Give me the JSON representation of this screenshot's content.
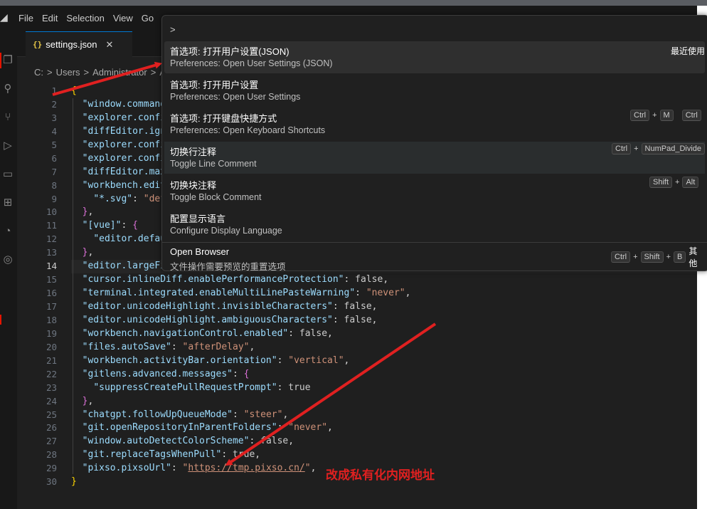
{
  "menu": {
    "items": [
      "File",
      "Edit",
      "Selection",
      "View",
      "Go"
    ]
  },
  "tab": {
    "icon": "{}",
    "label": "settings.json",
    "close": "✕"
  },
  "breadcrumb": [
    "C:",
    ">",
    "Users",
    ">",
    "Administrator",
    ">",
    "A"
  ],
  "editor": {
    "line_numbers": [
      "1",
      "2",
      "3",
      "4",
      "5",
      "6",
      "7",
      "8",
      "9",
      "10",
      "11",
      "12",
      "13",
      "14",
      "15",
      "16",
      "17",
      "18",
      "19",
      "20",
      "21",
      "22",
      "23",
      "24",
      "25",
      "26",
      "27",
      "28",
      "29",
      "30"
    ],
    "active_line": "14",
    "lines": [
      {
        "parts": [
          [
            "{",
            "br1"
          ]
        ]
      },
      {
        "parts": [
          [
            "  ",
            ""
          ],
          [
            "\"window.command",
            "k"
          ]
        ]
      },
      {
        "parts": [
          [
            "  ",
            ""
          ],
          [
            "\"explorer.confi",
            "k"
          ]
        ]
      },
      {
        "parts": [
          [
            "  ",
            ""
          ],
          [
            "\"diffEditor.ign",
            "k"
          ]
        ]
      },
      {
        "parts": [
          [
            "  ",
            ""
          ],
          [
            "\"explorer.confi",
            "k"
          ]
        ]
      },
      {
        "parts": [
          [
            "  ",
            ""
          ],
          [
            "\"explorer.confi",
            "k"
          ]
        ]
      },
      {
        "parts": [
          [
            "  ",
            ""
          ],
          [
            "\"diffEditor.max",
            "k"
          ]
        ]
      },
      {
        "parts": [
          [
            "  ",
            ""
          ],
          [
            "\"workbench.edit",
            "k"
          ]
        ]
      },
      {
        "parts": [
          [
            "    ",
            ""
          ],
          [
            "\"*.svg\"",
            "k"
          ],
          [
            ": ",
            "b"
          ],
          [
            "\"def",
            "s"
          ]
        ]
      },
      {
        "parts": [
          [
            "  ",
            ""
          ],
          [
            "}",
            "br2"
          ],
          [
            ",",
            "b"
          ]
        ]
      },
      {
        "parts": [
          [
            "  ",
            ""
          ],
          [
            "\"[vue]\"",
            "k"
          ],
          [
            ": ",
            "b"
          ],
          [
            "{",
            "br2"
          ]
        ]
      },
      {
        "parts": [
          [
            "    ",
            ""
          ],
          [
            "\"editor.defau",
            "k"
          ]
        ]
      },
      {
        "parts": [
          [
            "  ",
            ""
          ],
          [
            "}",
            "br2"
          ],
          [
            ",",
            "b"
          ]
        ]
      },
      {
        "parts": [
          [
            "  ",
            ""
          ],
          [
            "\"editor.largeFi",
            "k"
          ]
        ]
      },
      {
        "parts": [
          [
            "  ",
            ""
          ],
          [
            "\"cursor.inlineDiff.enablePerformanceProtection\"",
            "k"
          ],
          [
            ": ",
            "b"
          ],
          [
            "false",
            "kw"
          ],
          [
            ",",
            "b"
          ]
        ]
      },
      {
        "parts": [
          [
            "  ",
            ""
          ],
          [
            "\"terminal.integrated.enableMultiLinePasteWarning\"",
            "k"
          ],
          [
            ": ",
            "b"
          ],
          [
            "\"never\"",
            "s"
          ],
          [
            ",",
            "b"
          ]
        ]
      },
      {
        "parts": [
          [
            "  ",
            ""
          ],
          [
            "\"editor.unicodeHighlight.invisibleCharacters\"",
            "k"
          ],
          [
            ": ",
            "b"
          ],
          [
            "false",
            "kw"
          ],
          [
            ",",
            "b"
          ]
        ]
      },
      {
        "parts": [
          [
            "  ",
            ""
          ],
          [
            "\"editor.unicodeHighlight.ambiguousCharacters\"",
            "k"
          ],
          [
            ": ",
            "b"
          ],
          [
            "false",
            "kw"
          ],
          [
            ",",
            "b"
          ]
        ]
      },
      {
        "parts": [
          [
            "  ",
            ""
          ],
          [
            "\"workbench.navigationControl.enabled\"",
            "k"
          ],
          [
            ": ",
            "b"
          ],
          [
            "false",
            "kw"
          ],
          [
            ",",
            "b"
          ]
        ]
      },
      {
        "parts": [
          [
            "  ",
            ""
          ],
          [
            "\"files.autoSave\"",
            "k"
          ],
          [
            ": ",
            "b"
          ],
          [
            "\"afterDelay\"",
            "s"
          ],
          [
            ",",
            "b"
          ]
        ]
      },
      {
        "parts": [
          [
            "  ",
            ""
          ],
          [
            "\"workbench.activityBar.orientation\"",
            "k"
          ],
          [
            ": ",
            "b"
          ],
          [
            "\"vertical\"",
            "s"
          ],
          [
            ",",
            "b"
          ]
        ]
      },
      {
        "parts": [
          [
            "  ",
            ""
          ],
          [
            "\"gitlens.advanced.messages\"",
            "k"
          ],
          [
            ": ",
            "b"
          ],
          [
            "{",
            "br2"
          ]
        ]
      },
      {
        "parts": [
          [
            "    ",
            ""
          ],
          [
            "\"suppressCreatePullRequestPrompt\"",
            "k"
          ],
          [
            ": ",
            "b"
          ],
          [
            "true",
            "kw"
          ]
        ]
      },
      {
        "parts": [
          [
            "  ",
            ""
          ],
          [
            "}",
            "br2"
          ],
          [
            ",",
            "b"
          ]
        ]
      },
      {
        "parts": [
          [
            "  ",
            ""
          ],
          [
            "\"chatgpt.followUpQueueMode\"",
            "k"
          ],
          [
            ": ",
            "b"
          ],
          [
            "\"steer\"",
            "s"
          ],
          [
            ",",
            "b"
          ]
        ]
      },
      {
        "parts": [
          [
            "  ",
            ""
          ],
          [
            "\"git.openRepositoryInParentFolders\"",
            "k"
          ],
          [
            ": ",
            "b"
          ],
          [
            "\"never\"",
            "s"
          ],
          [
            ",",
            "b"
          ]
        ]
      },
      {
        "parts": [
          [
            "  ",
            ""
          ],
          [
            "\"window.autoDetectColorScheme\"",
            "k"
          ],
          [
            ": ",
            "b"
          ],
          [
            "false",
            "kw"
          ],
          [
            ",",
            "b"
          ]
        ]
      },
      {
        "parts": [
          [
            "  ",
            ""
          ],
          [
            "\"git.replaceTagsWhenPull\"",
            "k"
          ],
          [
            ": ",
            "b"
          ],
          [
            "true",
            "kw"
          ],
          [
            ",",
            "b"
          ]
        ]
      },
      {
        "parts": [
          [
            "  ",
            ""
          ],
          [
            "\"pixso.pixsoUrl\"",
            "k"
          ],
          [
            ": ",
            "b"
          ],
          [
            "\"",
            "s"
          ],
          [
            "https://tmp.pixso.cn/",
            "link"
          ],
          [
            "\"",
            "s"
          ],
          [
            ",",
            "b"
          ]
        ]
      },
      {
        "parts": [
          [
            "}",
            "br1"
          ]
        ]
      }
    ]
  },
  "palette": {
    "input_value": ">",
    "items": [
      {
        "title": "首选项: 打开用户设置(JSON)",
        "subtitle": "Preferences: Open User Settings (JSON)",
        "right_label": "最近使用",
        "keys": []
      },
      {
        "title": "首选项: 打开用户设置",
        "subtitle": "Preferences: Open User Settings",
        "right_label": "",
        "keys": []
      },
      {
        "title": "首选项: 打开键盘快捷方式",
        "subtitle": "Preferences: Open Keyboard Shortcuts",
        "right_label": "",
        "keys": [
          "Ctrl",
          "+",
          "M",
          "Ctrl"
        ]
      },
      {
        "title": "切换行注释",
        "subtitle": "Toggle Line Comment",
        "right_label": "",
        "keys": [
          "Ctrl",
          "+",
          "NumPad_Divide"
        ]
      },
      {
        "title": "切换块注释",
        "subtitle": "Toggle Block Comment",
        "right_label": "",
        "keys": [
          "Shift",
          "+",
          "Alt"
        ]
      },
      {
        "title": "配置显示语言",
        "subtitle": "Configure Display Language",
        "right_label": "",
        "keys": []
      },
      {
        "title": "Open Browser",
        "subtitle": "文件操作需要预览的重置选项",
        "right_label": "",
        "keys": [
          "Ctrl",
          "+",
          "Shift",
          "+",
          "B"
        ],
        "extra": "其他"
      }
    ]
  },
  "annotation": {
    "text": "改成私有化内网地址",
    "color": "#e02020"
  },
  "icons": {
    "activity": [
      "explorer-icon",
      "search-icon",
      "source-control-icon",
      "run-debug-icon",
      "remote-icon",
      "extensions-icon",
      "git-graph-icon",
      "accounts-icon"
    ]
  }
}
